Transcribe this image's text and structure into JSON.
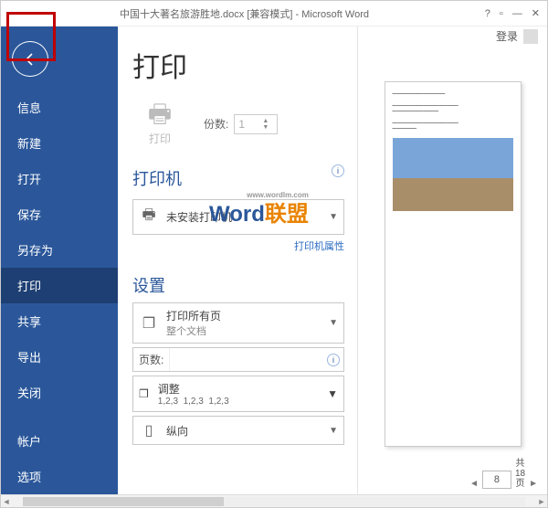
{
  "titlebar": {
    "title": "中国十大著名旅游胜地.docx [兼容模式] - Microsoft Word",
    "help": "?",
    "login": "登录"
  },
  "sidebar": {
    "items": [
      "信息",
      "新建",
      "打开",
      "保存",
      "另存为",
      "打印",
      "共享",
      "导出",
      "关闭"
    ],
    "bottom": [
      "帐户",
      "选项"
    ],
    "active_index": 5
  },
  "print": {
    "title": "打印",
    "print_btn": "打印",
    "copies_label": "份数:",
    "copies_value": "1"
  },
  "printer": {
    "section": "打印机",
    "name": "未安装打印机",
    "props": "打印机属性"
  },
  "settings": {
    "section": "设置",
    "scope_title": "打印所有页",
    "scope_sub": "整个文档",
    "pages_label": "页数:",
    "collate_label": "调整",
    "seq": "1,2,3",
    "orientation": "纵向"
  },
  "pager": {
    "current": "8",
    "total_top": "共",
    "total_mid": "18",
    "total_bot": "页"
  },
  "watermark": {
    "url": "www.wordlm.com",
    "t1": "W",
    "t2": "ord",
    "t3": "联盟"
  }
}
